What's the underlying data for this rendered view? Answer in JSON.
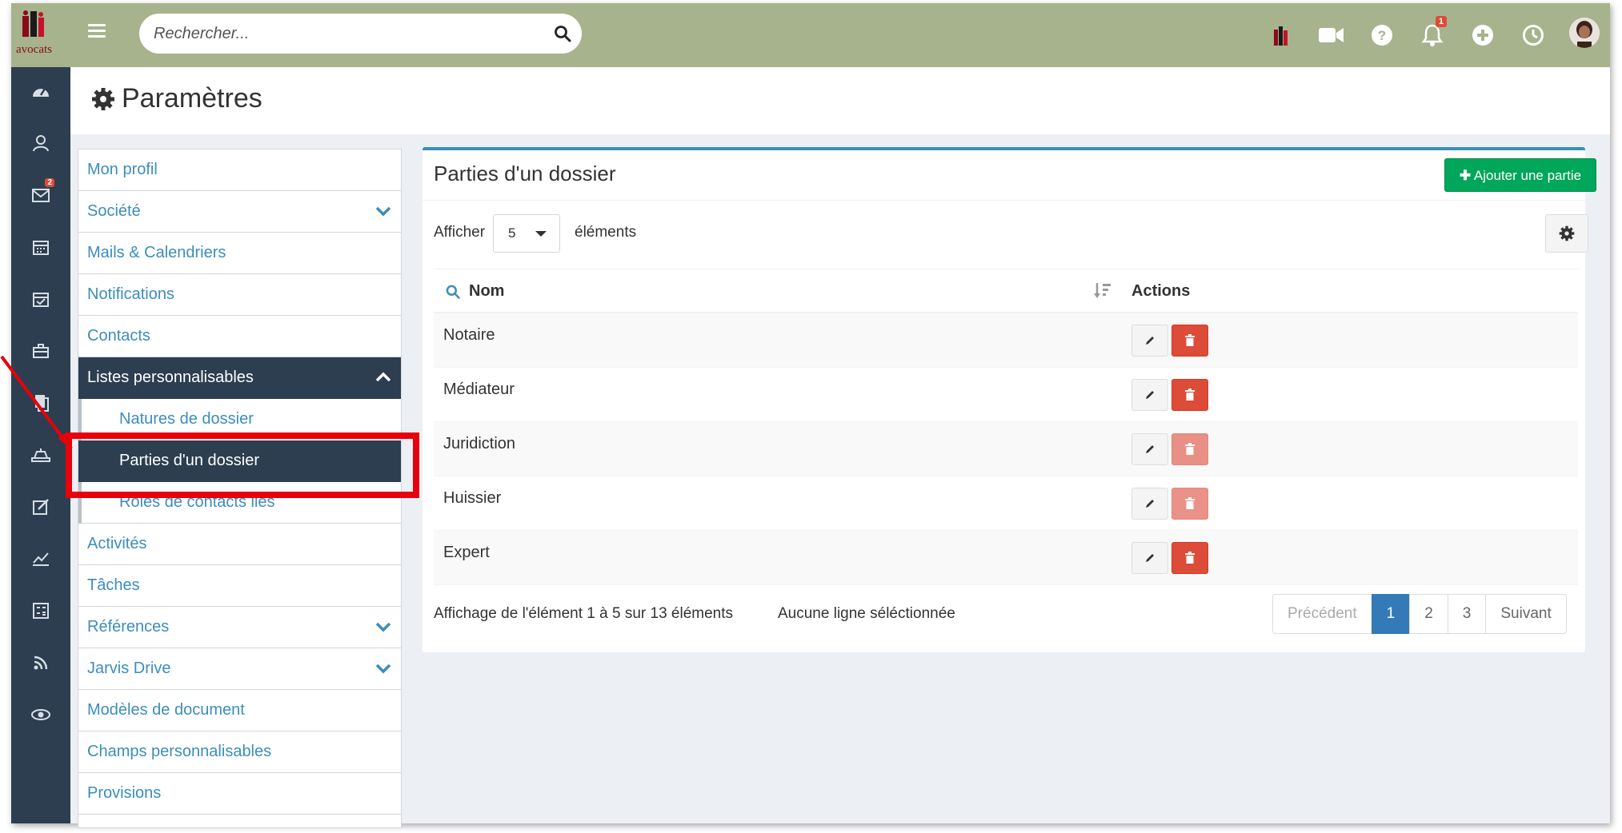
{
  "topbar": {
    "search_placeholder": "Rechercher...",
    "logo_text": "avocats",
    "notification_count": "1",
    "icons": [
      "app-logo-icon",
      "video-icon",
      "help-icon",
      "bell-icon",
      "plus-circle-icon",
      "clock-icon"
    ]
  },
  "sidebar": {
    "mail_badge": "2",
    "icons": [
      "dashboard-icon",
      "contacts-icon",
      "mail-icon",
      "calendar-icon",
      "calendar-check-icon",
      "briefcase-icon",
      "documents-icon",
      "court-icon",
      "edit-icon",
      "chart-icon",
      "calculator-icon",
      "rss-icon",
      "eye-icon"
    ]
  },
  "page": {
    "title": "Paramètres"
  },
  "menu": {
    "items": [
      {
        "label": "Mon profil"
      },
      {
        "label": "Société"
      },
      {
        "label": "Mails & Calendriers"
      },
      {
        "label": "Notifications"
      },
      {
        "label": "Contacts"
      },
      {
        "label": "Listes personnalisables"
      },
      {
        "label": "Activités"
      },
      {
        "label": "Tâches"
      },
      {
        "label": "Références"
      },
      {
        "label": "Jarvis Drive"
      },
      {
        "label": "Modèles de document"
      },
      {
        "label": "Champs personnalisables"
      },
      {
        "label": "Provisions"
      }
    ],
    "subitems": [
      {
        "label": "Natures de dossier"
      },
      {
        "label": "Parties d'un dossier"
      },
      {
        "label": "Rôles de contacts liés"
      }
    ]
  },
  "panel": {
    "title": "Parties d'un dossier",
    "add_button": "Ajouter une partie",
    "show_label": "Afficher",
    "page_size": "5",
    "elements_label": "éléments",
    "col_name": "Nom",
    "col_actions": "Actions",
    "rows": [
      {
        "name": "Notaire",
        "delete_enabled": true
      },
      {
        "name": "Médiateur",
        "delete_enabled": true
      },
      {
        "name": "Juridiction",
        "delete_enabled": false
      },
      {
        "name": "Huissier",
        "delete_enabled": false
      },
      {
        "name": "Expert",
        "delete_enabled": true
      }
    ],
    "info": "Affichage de l'élément 1 à 5 sur 13 éléments",
    "selection_info": "Aucune ligne séléctionnée",
    "pagination": {
      "prev": "Précédent",
      "pages": [
        "1",
        "2",
        "3"
      ],
      "next": "Suivant",
      "current": "1"
    }
  },
  "colors": {
    "topbar": "#a7b38c",
    "sidebar": "#2c3e50",
    "link": "#3c8dbc",
    "add_button": "#00a65a",
    "delete_button": "#dd4b39",
    "highlight": "#e8000b"
  }
}
